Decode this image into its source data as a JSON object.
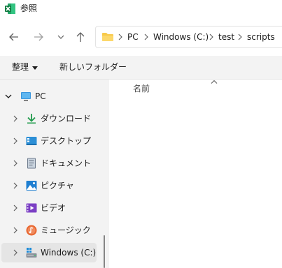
{
  "window": {
    "title": "参照",
    "app_icon": "excel-icon",
    "accent": "#1d6f42"
  },
  "navigation": {
    "back_icon": "arrow-left-icon",
    "forward_icon": "arrow-right-icon",
    "recent_icon": "chevron-down-icon",
    "up_icon": "arrow-up-icon"
  },
  "address_bar": {
    "folder_icon": "folder-icon",
    "crumbs": [
      "PC",
      "Windows (C:)",
      "test",
      "scripts"
    ]
  },
  "command_bar": {
    "organize": "整理",
    "new_folder": "新しいフォルダー"
  },
  "nav_pane": {
    "items": [
      {
        "label": "PC",
        "icon": "pc-icon",
        "expanded": true
      },
      {
        "label": "ダウンロード",
        "icon": "download-icon"
      },
      {
        "label": "デスクトップ",
        "icon": "desktop-icon"
      },
      {
        "label": "ドキュメント",
        "icon": "documents-icon"
      },
      {
        "label": "ピクチャ",
        "icon": "pictures-icon"
      },
      {
        "label": "ビデオ",
        "icon": "videos-icon"
      },
      {
        "label": "ミュージック",
        "icon": "music-icon"
      },
      {
        "label": "Windows (C:)",
        "icon": "drive-icon",
        "selected": true
      }
    ]
  },
  "content": {
    "name_column": "名前",
    "sort_icon": "sort-ascending-icon"
  }
}
